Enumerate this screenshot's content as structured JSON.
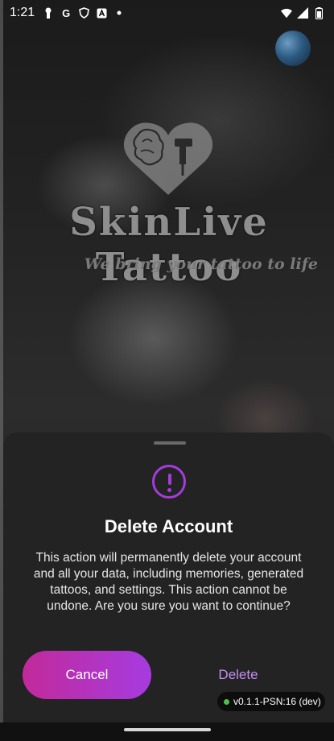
{
  "status_bar": {
    "time": "1:21",
    "left_icons": [
      "keyhole-icon",
      "google-icon",
      "shield-icon",
      "a-box-icon",
      "dot-icon"
    ],
    "google_glyph": "G",
    "right_icons": [
      "wifi-icon",
      "signal-icon",
      "battery-icon"
    ]
  },
  "brand": {
    "title": "SkinLive Tattoo",
    "tagline": "We bring your tattoo to life"
  },
  "dialog": {
    "title": "Delete Account",
    "body": "This action will permanently delete your account and all your data, including memories, generated tattoos, and settings. This action cannot be undone. Are you sure you want to continue?",
    "cancel_label": "Cancel",
    "delete_label": "Delete",
    "accent_color": "#a53bdc"
  },
  "version_badge": {
    "text": "v0.1.1-PSN:16 (dev)",
    "status_color": "#4cc04c"
  }
}
